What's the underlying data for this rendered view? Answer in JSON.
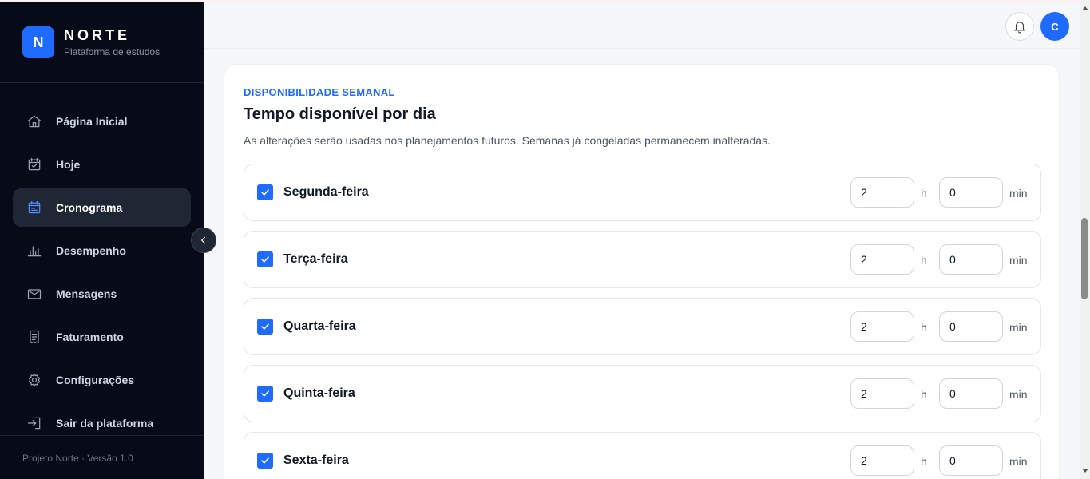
{
  "app": {
    "logo_letter": "N",
    "name": "NORTE",
    "subtitle": "Plataforma de estudos"
  },
  "sidebar": {
    "items": [
      {
        "label": "Página Inicial",
        "icon": "home-icon",
        "active": false
      },
      {
        "label": "Hoje",
        "icon": "calendar-check-icon",
        "active": false
      },
      {
        "label": "Cronograma",
        "icon": "calendar-icon",
        "active": true
      },
      {
        "label": "Desempenho",
        "icon": "bar-chart-icon",
        "active": false
      },
      {
        "label": "Mensagens",
        "icon": "mail-icon",
        "active": false
      },
      {
        "label": "Faturamento",
        "icon": "receipt-icon",
        "active": false
      },
      {
        "label": "Configurações",
        "icon": "gear-icon",
        "active": false
      },
      {
        "label": "Sair da plataforma",
        "icon": "logout-icon",
        "active": false
      }
    ],
    "footer": "Projeto Norte · Versão 1.0"
  },
  "header": {
    "avatar_initial": "C"
  },
  "availability": {
    "eyebrow": "DISPONIBILIDADE SEMANAL",
    "title": "Tempo disponível por dia",
    "description": "As alterações serão usadas nos planejamentos futuros. Semanas já congeladas permanecem inalteradas.",
    "hours_unit": "h",
    "minutes_unit": "min",
    "days": [
      {
        "label": "Segunda-feira",
        "checked": true,
        "hours": "2",
        "minutes": "0"
      },
      {
        "label": "Terça-feira",
        "checked": true,
        "hours": "2",
        "minutes": "0"
      },
      {
        "label": "Quarta-feira",
        "checked": true,
        "hours": "2",
        "minutes": "0"
      },
      {
        "label": "Quinta-feira",
        "checked": true,
        "hours": "2",
        "minutes": "0"
      },
      {
        "label": "Sexta-feira",
        "checked": true,
        "hours": "2",
        "minutes": "0"
      }
    ]
  },
  "colors": {
    "accent": "#1f6bff",
    "sidebar_bg": "#070b18",
    "page_bg": "#f6f7f9"
  }
}
